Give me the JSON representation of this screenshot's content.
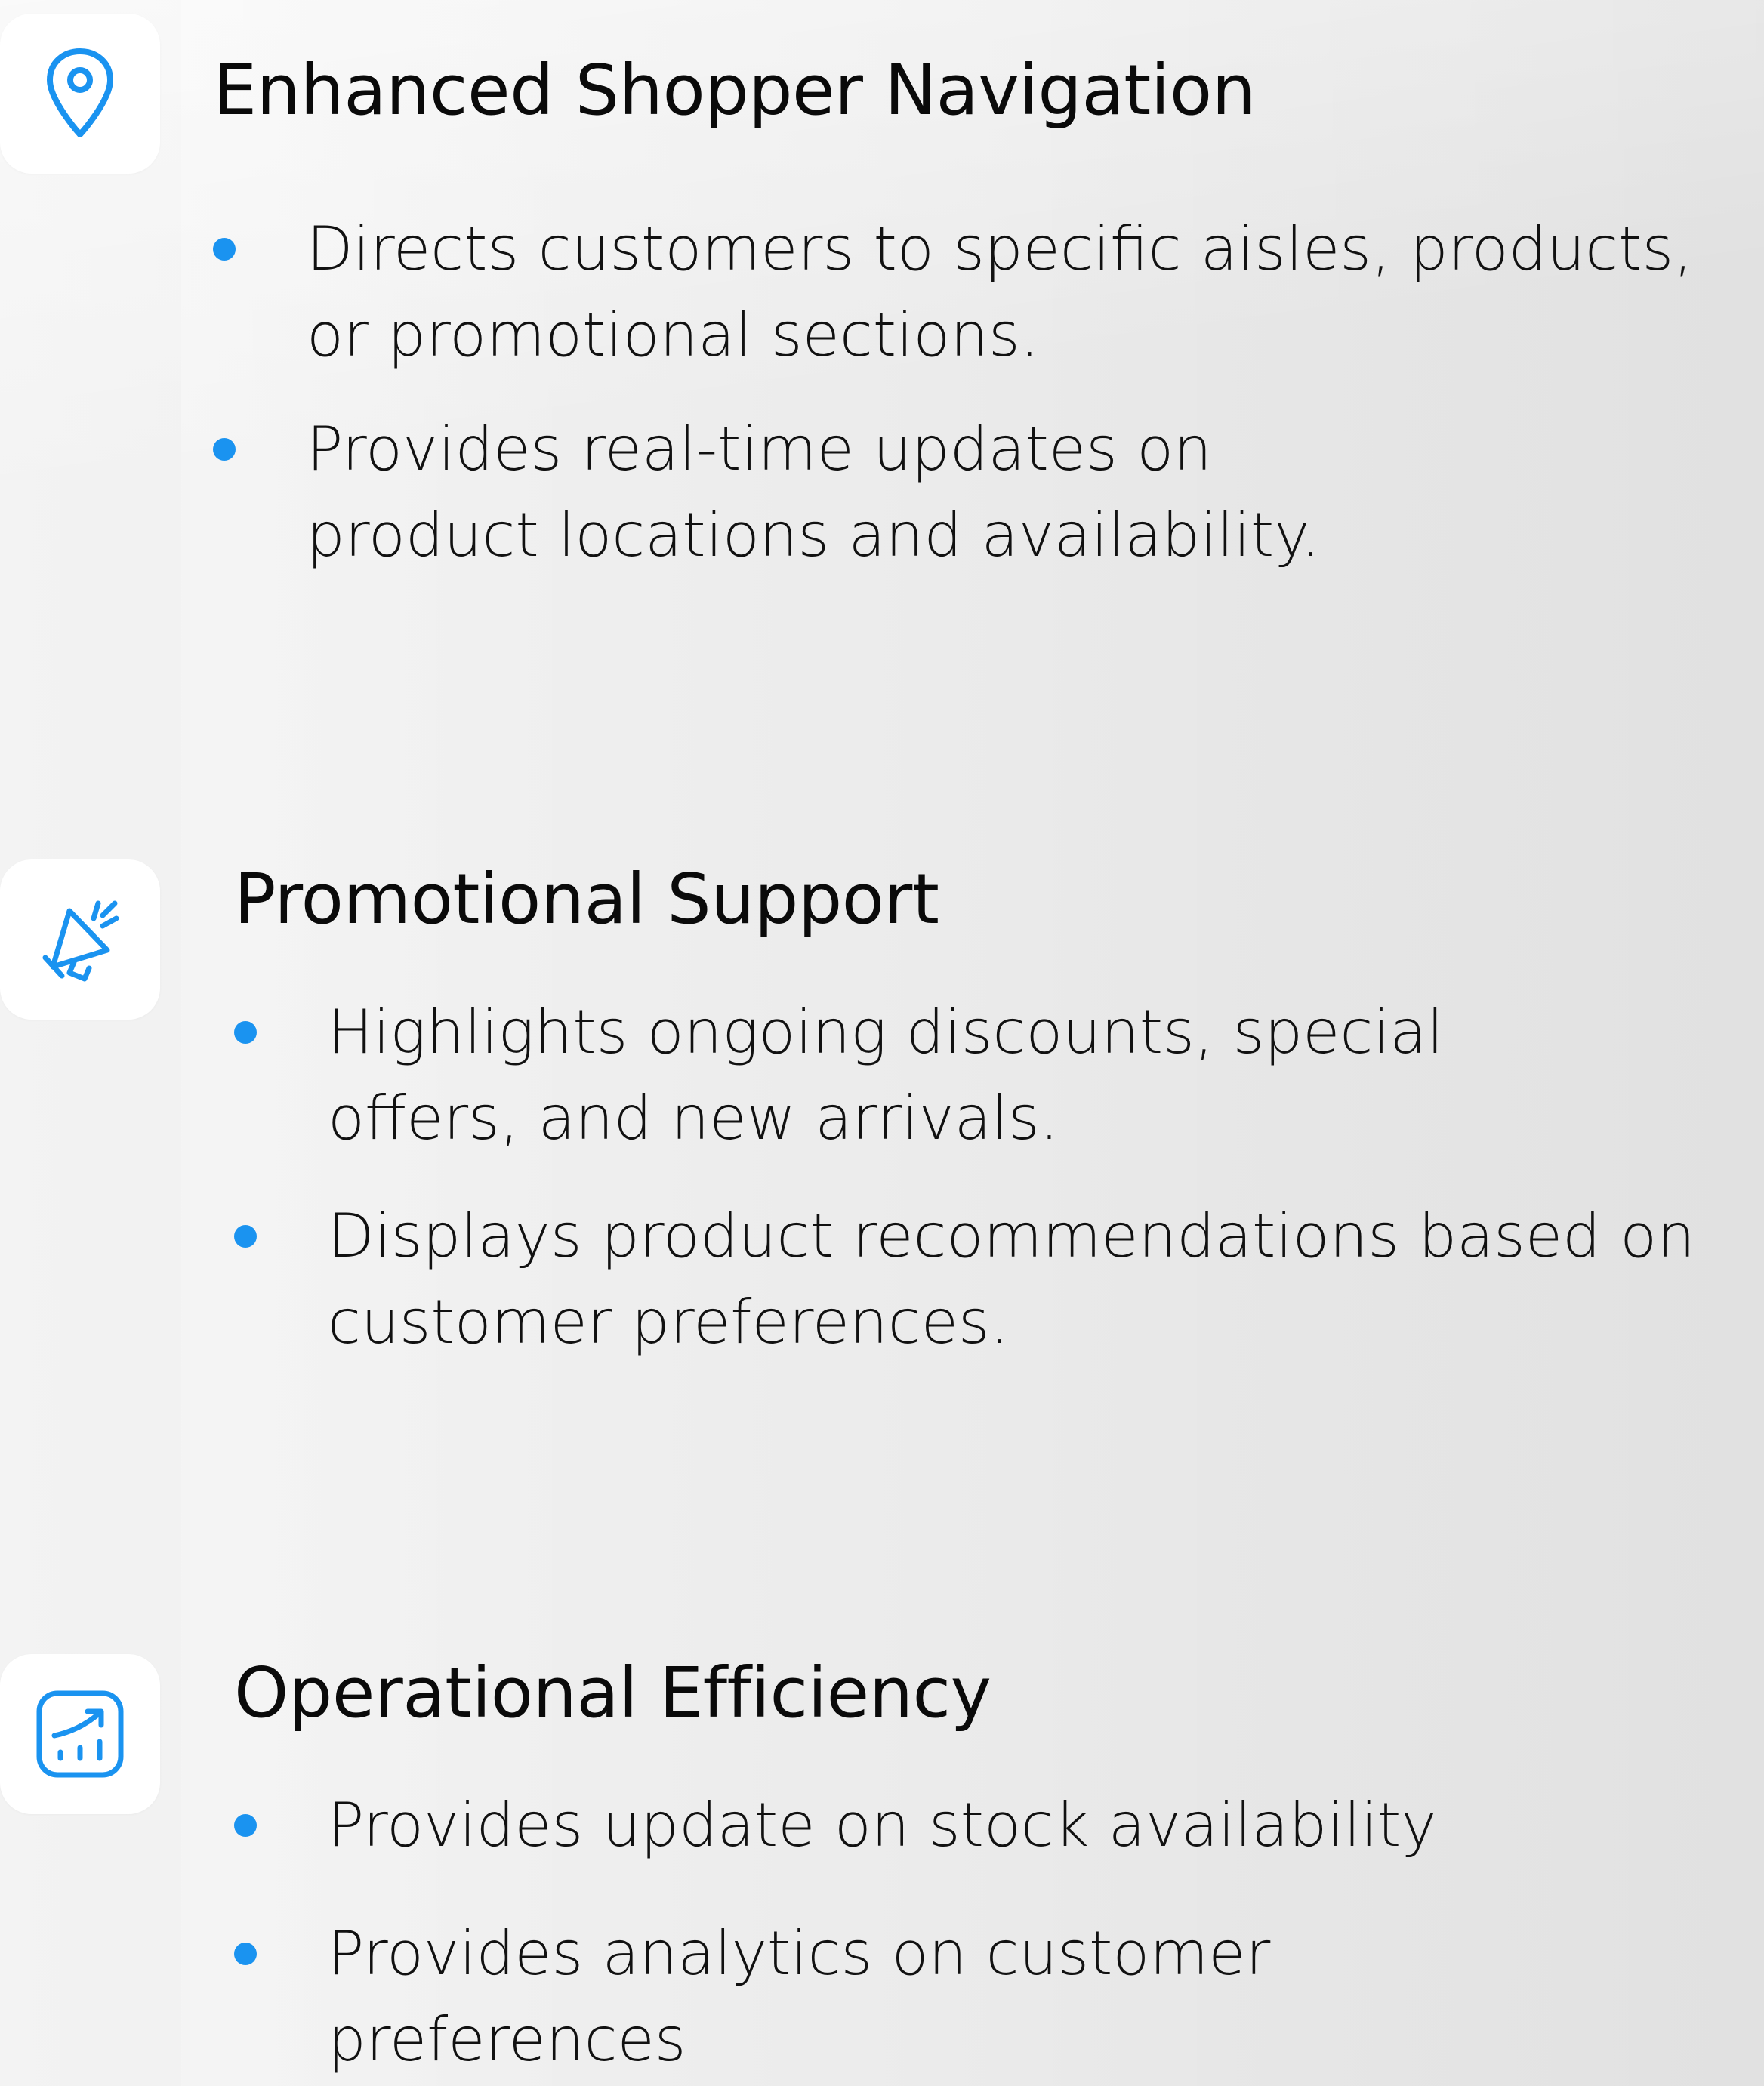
{
  "sections": [
    {
      "icon": "map-pin-icon",
      "title": "Enhanced Shopper Navigation",
      "bullets": [
        {
          "lines": [
            "Directs customers to specific aisles, products,",
            "or promotional sections."
          ]
        },
        {
          "lines": [
            "Provides real-time updates on",
            "product locations and availability."
          ]
        }
      ]
    },
    {
      "icon": "megaphone-icon",
      "title": "Promotional Support",
      "bullets": [
        {
          "lines": [
            "Highlights ongoing discounts, special",
            "offers, and new arrivals."
          ]
        },
        {
          "lines": [
            "Displays product recommendations based on",
            "customer preferences."
          ]
        }
      ]
    },
    {
      "icon": "analytics-chart-icon",
      "title": "Operational Efficiency",
      "bullets": [
        {
          "lines": [
            "Provides update on stock availability"
          ]
        },
        {
          "lines": [
            "Provides analytics on customer",
            "preferences"
          ]
        }
      ]
    }
  ],
  "colors": {
    "accent": "#1a93f0",
    "text": "#0a0a0a",
    "tile": "#ffffff"
  }
}
